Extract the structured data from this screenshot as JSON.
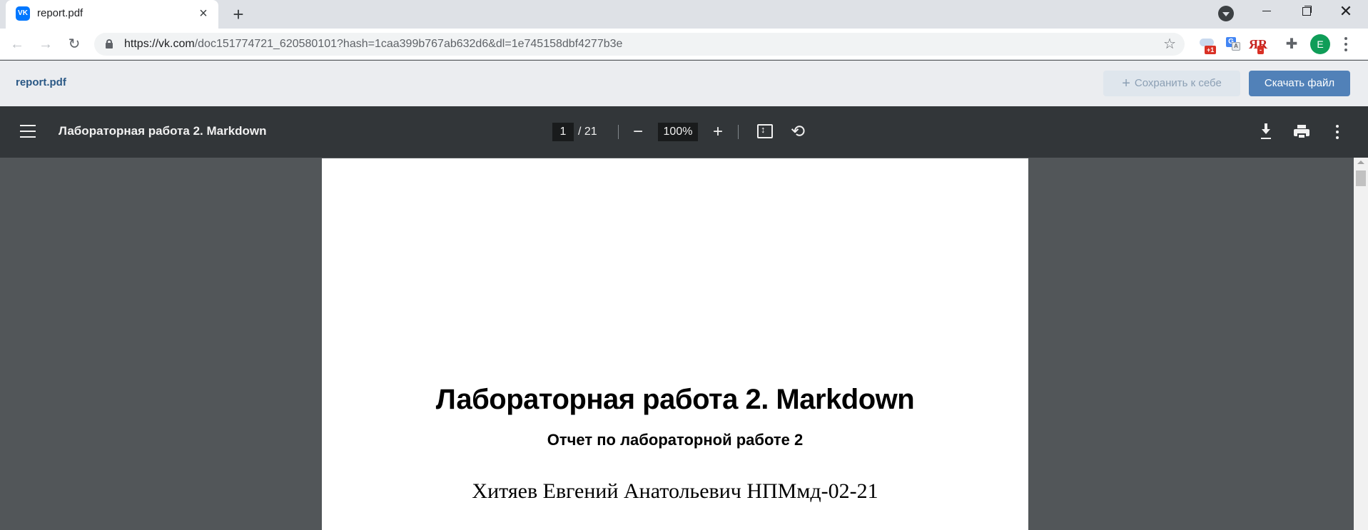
{
  "browser": {
    "tab": {
      "title": "report.pdf",
      "favicon": "vk-icon"
    },
    "url": {
      "host": "https://vk.com",
      "path": "/doc151774721_620580101?hash=1caa399b767ab632d6&dl=1e745158dbf4277b3e"
    },
    "extensions": {
      "cloud_badge": "+1",
      "translate_g": "G",
      "translate_t": "A",
      "lang_label": "ЯR",
      "lang_badge": "-"
    },
    "profile_initial": "E"
  },
  "vk": {
    "filename": "report.pdf",
    "save_button": "Сохранить к себе",
    "save_plus": "+",
    "download_button": "Скачать файл",
    "colors": {
      "link": "#2a5885",
      "primary": "#5181b8"
    }
  },
  "pdf_toolbar": {
    "title": "Лабораторная работа 2. Markdown",
    "current_page": "1",
    "total_pages": "/ 21",
    "zoom": "100%",
    "zoom_out": "−",
    "zoom_in": "+",
    "rotate": "⟲"
  },
  "document": {
    "title": "Лабораторная работа 2. Markdown",
    "subtitle": "Отчет по лабораторной работе 2",
    "author": "Хитяев Евгений Анатольевич НПМмд-02-21"
  }
}
